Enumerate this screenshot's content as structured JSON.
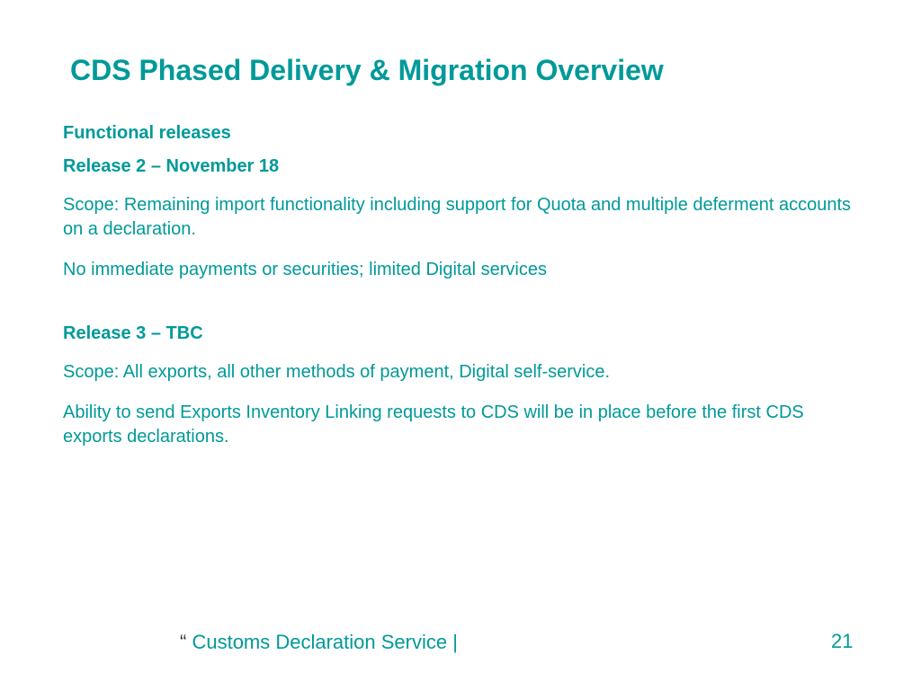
{
  "title": "CDS Phased Delivery & Migration Overview",
  "sections": {
    "header1": "Functional releases",
    "release2_title": "Release 2 – November 18",
    "release2_scope": "Scope:  Remaining import functionality including support for Quota and multiple deferment accounts on a declaration.",
    "release2_note": "No immediate payments or securities; limited Digital services",
    "release3_title": "Release 3 – TBC",
    "release3_scope": "Scope: All exports, all other methods of payment, Digital self-service.",
    "release3_note": "Ability to send Exports Inventory Linking requests to CDS will be in place before the first CDS exports declarations."
  },
  "footer": {
    "quote": "“ ",
    "service_name": "Customs Declaration Service ",
    "separator": " |",
    "page_number": "21"
  }
}
